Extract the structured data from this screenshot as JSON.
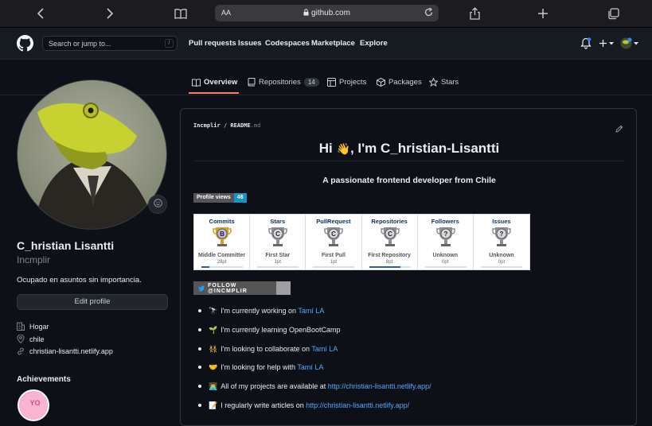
{
  "browser": {
    "aa": "AA",
    "url": "github.com"
  },
  "header": {
    "search_placeholder": "Search or jump to...",
    "slash": "/",
    "nav": [
      "Pull requests",
      "Issues",
      "Codespaces",
      "Marketplace",
      "Explore"
    ]
  },
  "tabs": [
    {
      "label": "Overview"
    },
    {
      "label": "Repositories",
      "count": "14"
    },
    {
      "label": "Projects"
    },
    {
      "label": "Packages"
    },
    {
      "label": "Stars"
    }
  ],
  "profile": {
    "name": "C_hristian Lisantti",
    "username": "Incmplir",
    "bio": "Ocupado en asuntos sin importancia.",
    "edit_label": "Edit profile",
    "company": "Hogar",
    "location": "chile",
    "website": "christian-lisantti.netlify.app",
    "achievements_title": "Achievements"
  },
  "readme": {
    "user": "Incmplir",
    "sep": "/",
    "file": "README",
    "ext": ".md",
    "heading_pre": "Hi ",
    "heading_post": ", I'm C_hristian-Lisantti",
    "subtitle": "A passionate frontend developer from Chile",
    "profile_views_label": "Profile views",
    "profile_views_count": "46",
    "follow_label": "FOLLOW @INCMPLIR",
    "trophies": [
      {
        "title": "Commits",
        "rank": "B",
        "name": "Middle Committer",
        "pts": "28pt",
        "progress": 0.2
      },
      {
        "title": "Stars",
        "rank": "C",
        "name": "First Star",
        "pts": "1pt",
        "progress": 0.0
      },
      {
        "title": "PullRequest",
        "rank": "C",
        "name": "First Pull",
        "pts": "1pt",
        "progress": 0.0
      },
      {
        "title": "Repositories",
        "rank": "C",
        "name": "First Repository",
        "pts": "8pt",
        "progress": 0.75
      },
      {
        "title": "Followers",
        "rank": "?",
        "name": "Unknown",
        "pts": "0pt",
        "progress": 0.0
      },
      {
        "title": "Issues",
        "rank": "?",
        "name": "Unknown",
        "pts": "0pt",
        "progress": 0.0
      }
    ],
    "bullets": [
      {
        "emoji": "🔭",
        "text": "I'm currently working on ",
        "link": "Tamí LA"
      },
      {
        "emoji": "🌱",
        "text": "I'm currently learning OpenBootCamp",
        "link": ""
      },
      {
        "emoji": "👯",
        "text": "I'm looking to collaborate on ",
        "link": "Tamí LA"
      },
      {
        "emoji": "🤝",
        "text": "I'm looking for help with ",
        "link": "Tamí LA"
      },
      {
        "emoji": "👨‍💻",
        "text": "All of my projects are available at ",
        "link": "http://christian-lisantti.netlify.app/"
      },
      {
        "emoji": "📝",
        "text": "I regularly write articles on ",
        "link": "http://christian-lisantti.netlify.app/"
      }
    ]
  },
  "colors": {
    "accent": "#f78166",
    "link": "#58a6ff",
    "bg": "#0d1117"
  }
}
